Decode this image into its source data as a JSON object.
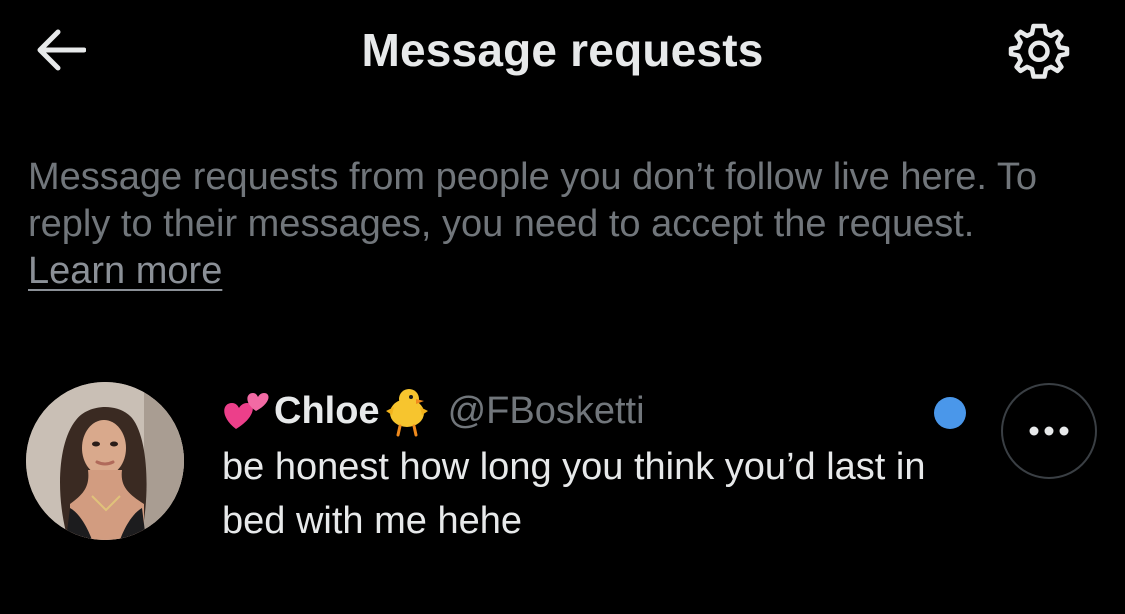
{
  "header": {
    "title": "Message requests",
    "back_icon": "arrow-left-icon",
    "settings_icon": "gear-icon"
  },
  "info": {
    "text": "Message requests from people you don’t follow live here. To reply to their messages, you need to accept the request.",
    "learn_more": "Learn more"
  },
  "requests": [
    {
      "display_name": "Chloe",
      "name_prefix_emoji": "two-hearts-emoji",
      "name_suffix_emoji": "chick-emoji",
      "handle": "@FBosketti",
      "preview": "be honest how long you think you’d last in bed with me hehe",
      "unread": true,
      "more_icon": "more-horizontal-icon"
    }
  ],
  "colors": {
    "background": "#000000",
    "primary_text": "#e7e9ea",
    "secondary_text": "#71767b",
    "unread_dot": "#4a97ea",
    "border": "#3a3f44"
  }
}
